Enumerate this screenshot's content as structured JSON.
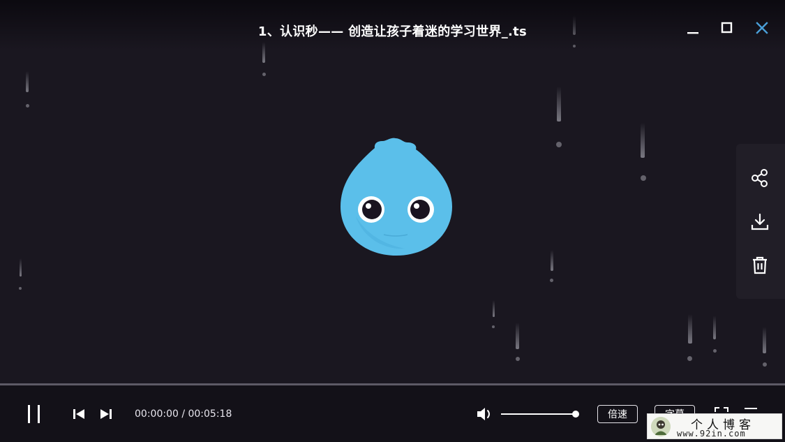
{
  "window": {
    "title": "1、认识秒—— 创造让孩子着迷的学习世界_.ts",
    "minimize_icon": "minimize-icon",
    "maximize_icon": "maximize-icon",
    "close_icon": "close-icon",
    "close_color": "#4a9fd8"
  },
  "side_panel": {
    "items": [
      {
        "icon": "share-icon"
      },
      {
        "icon": "download-icon"
      },
      {
        "icon": "trash-icon"
      }
    ]
  },
  "player": {
    "progress": 0.0,
    "current_time": "00:00:00",
    "separator": " / ",
    "total_time": "00:05:18",
    "time_display": "00:00:00 / 00:05:18",
    "volume": 1.0,
    "speed_label": "倍速",
    "subtitle_label": "字幕",
    "play_state": "playing"
  },
  "watermark": {
    "line1": "个人博客",
    "line2": "www.92in.com"
  },
  "colors": {
    "background": "#1a1720",
    "mascot": "#5bbfea",
    "control_bar": "#131118"
  }
}
